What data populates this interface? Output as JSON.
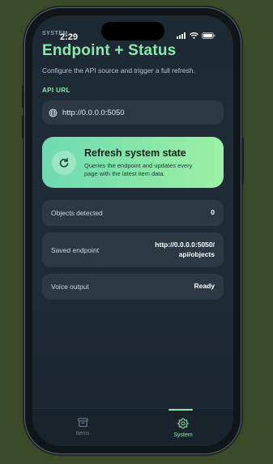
{
  "status_bar": {
    "time": "2:29",
    "overlay_label": "SYSTEM"
  },
  "header": {
    "title": "Endpoint + Status",
    "subtitle": "Configure the API source and trigger a full refresh."
  },
  "api_url": {
    "label": "API URL",
    "value": "http://0.0.0.0:5050",
    "icon": "globe-icon"
  },
  "refresh": {
    "title": "Refresh system state",
    "description": "Queries the endpoint and updates every page with the latest item data.",
    "icon": "refresh-icon"
  },
  "info_rows": [
    {
      "label": "Objects detected",
      "value": "0"
    },
    {
      "label": "Saved endpoint",
      "value_line1": "http://0.0.0.0:5050/",
      "value_line2": "api/objects"
    },
    {
      "label": "Voice output",
      "value": "Ready"
    }
  ],
  "tabs": [
    {
      "label": "Items",
      "icon": "archive-box-icon",
      "active": false
    },
    {
      "label": "System",
      "icon": "gear-icon",
      "active": true
    }
  ],
  "colors": {
    "accent": "#8de8b0",
    "background": "#1d2a33",
    "card": "#2c3944",
    "refresh_gradient_start": "#6fd9b3",
    "refresh_gradient_end": "#9df0a6"
  }
}
